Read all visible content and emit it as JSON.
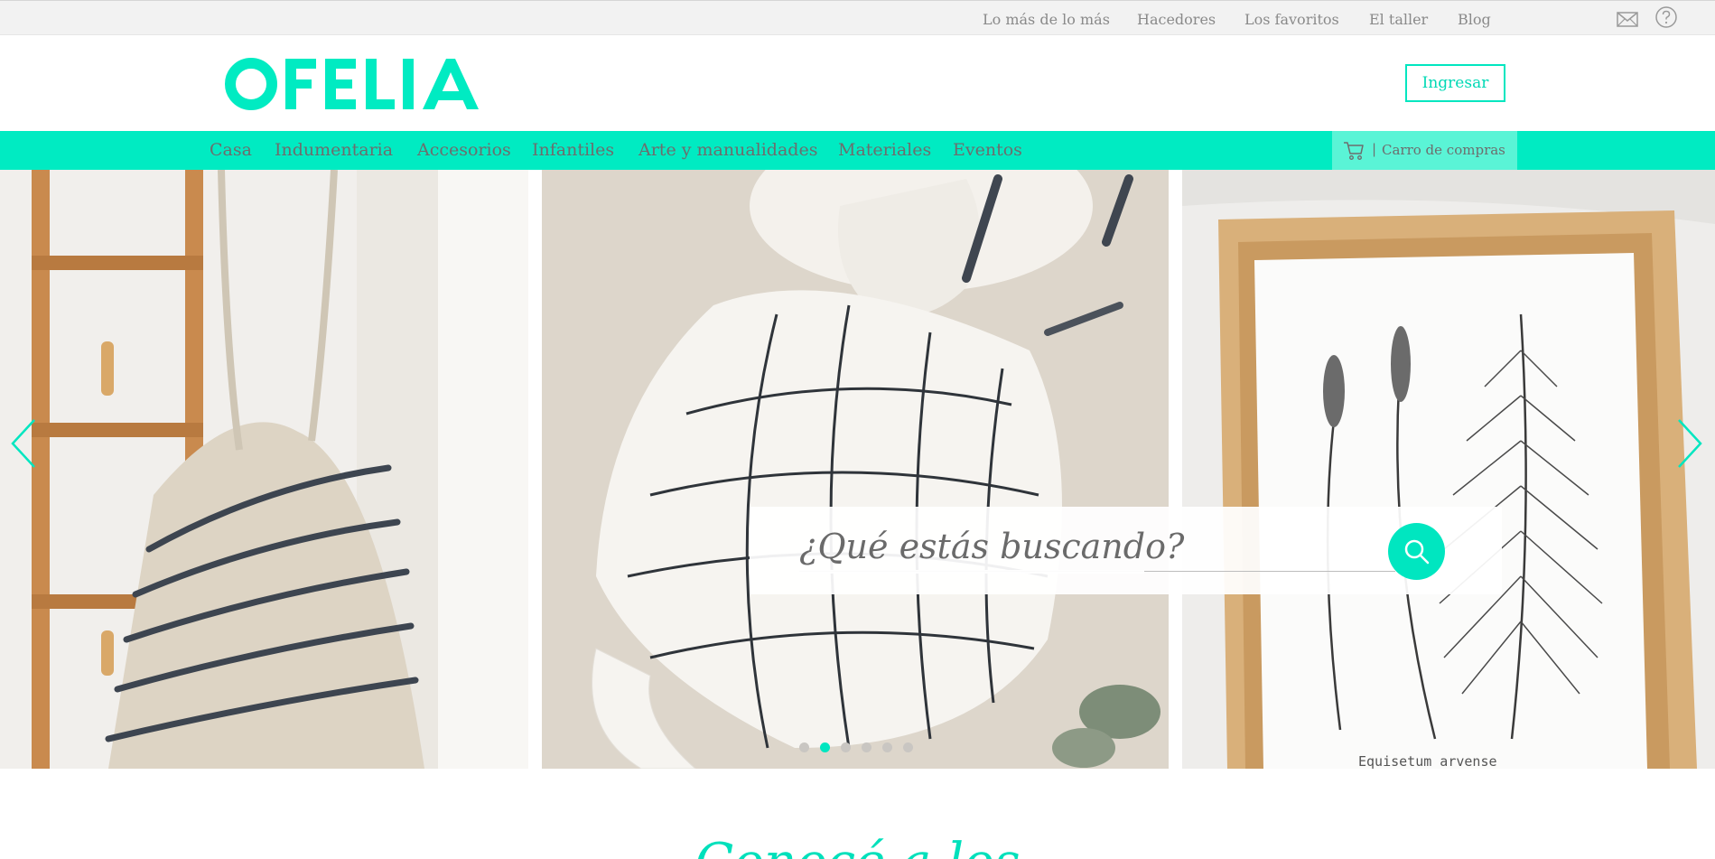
{
  "topbar": {
    "links": [
      {
        "label": "Lo más de lo más"
      },
      {
        "label": "Hacedores"
      },
      {
        "label": "Los favoritos"
      },
      {
        "label": "El taller"
      },
      {
        "label": "Blog"
      }
    ],
    "icons": [
      "mail-icon",
      "help-icon"
    ]
  },
  "header": {
    "logo_text": "OFELIA",
    "login_label": "Ingresar"
  },
  "nav": {
    "items": [
      {
        "label": "Casa"
      },
      {
        "label": "Indumentaria"
      },
      {
        "label": "Accesorios"
      },
      {
        "label": "Infantiles"
      },
      {
        "label": "Arte y manualidades"
      },
      {
        "label": "Materiales"
      },
      {
        "label": "Eventos"
      }
    ],
    "cart_separator": "|",
    "cart_label": "Carro de compras"
  },
  "hero": {
    "search_placeholder": "¿Qué estás buscando?",
    "slide_caption": "Equisetum arvense",
    "dots_count": 6,
    "active_dot": 2
  },
  "section": {
    "title_partial": "Conocé a los"
  },
  "colors": {
    "accent": "#00ebc2",
    "accent_light": "#5af4d6",
    "text_muted": "#8a8a8a"
  }
}
